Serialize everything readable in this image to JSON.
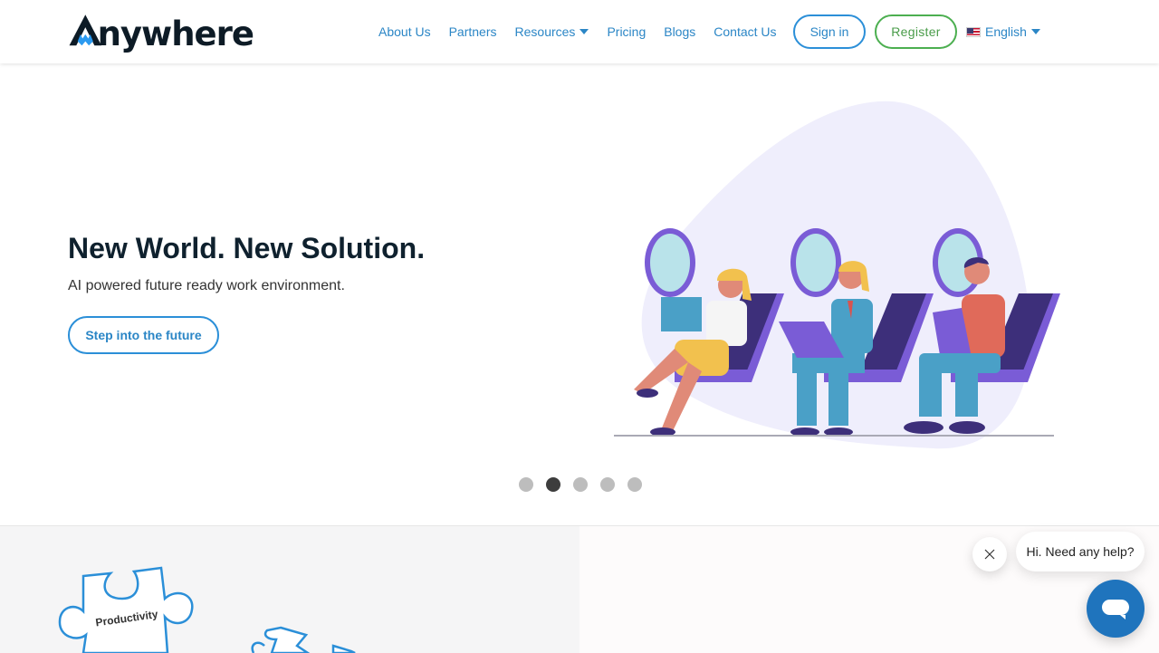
{
  "header": {
    "logo_text": "nywhere",
    "logo_alt": "Anywhere",
    "nav": [
      {
        "label": "About Us",
        "has_dropdown": false
      },
      {
        "label": "Partners",
        "has_dropdown": false
      },
      {
        "label": "Resources",
        "has_dropdown": true
      },
      {
        "label": "Pricing",
        "has_dropdown": false
      },
      {
        "label": "Blogs",
        "has_dropdown": false
      },
      {
        "label": "Contact Us",
        "has_dropdown": false
      }
    ],
    "signin_label": "Sign in",
    "register_label": "Register",
    "language": {
      "label": "English",
      "flag": "us-flag-icon"
    }
  },
  "colors": {
    "brand_blue": "#2b86c6",
    "register_green": "#4caf50",
    "heading_dark": "#0f212e",
    "chat_blue": "#1f74bd"
  },
  "hero": {
    "title": "New World. New Solution.",
    "subtitle": "AI powered future ready work environment.",
    "cta_label": "Step into the future",
    "carousel": {
      "total_slides": 5,
      "active_index": 1
    }
  },
  "section2": {
    "puzzle_label": "Productivity"
  },
  "chat": {
    "greeting": "Hi. Need any help?",
    "close_icon": "close-icon",
    "launcher_icon": "chat-bubble-icon"
  }
}
